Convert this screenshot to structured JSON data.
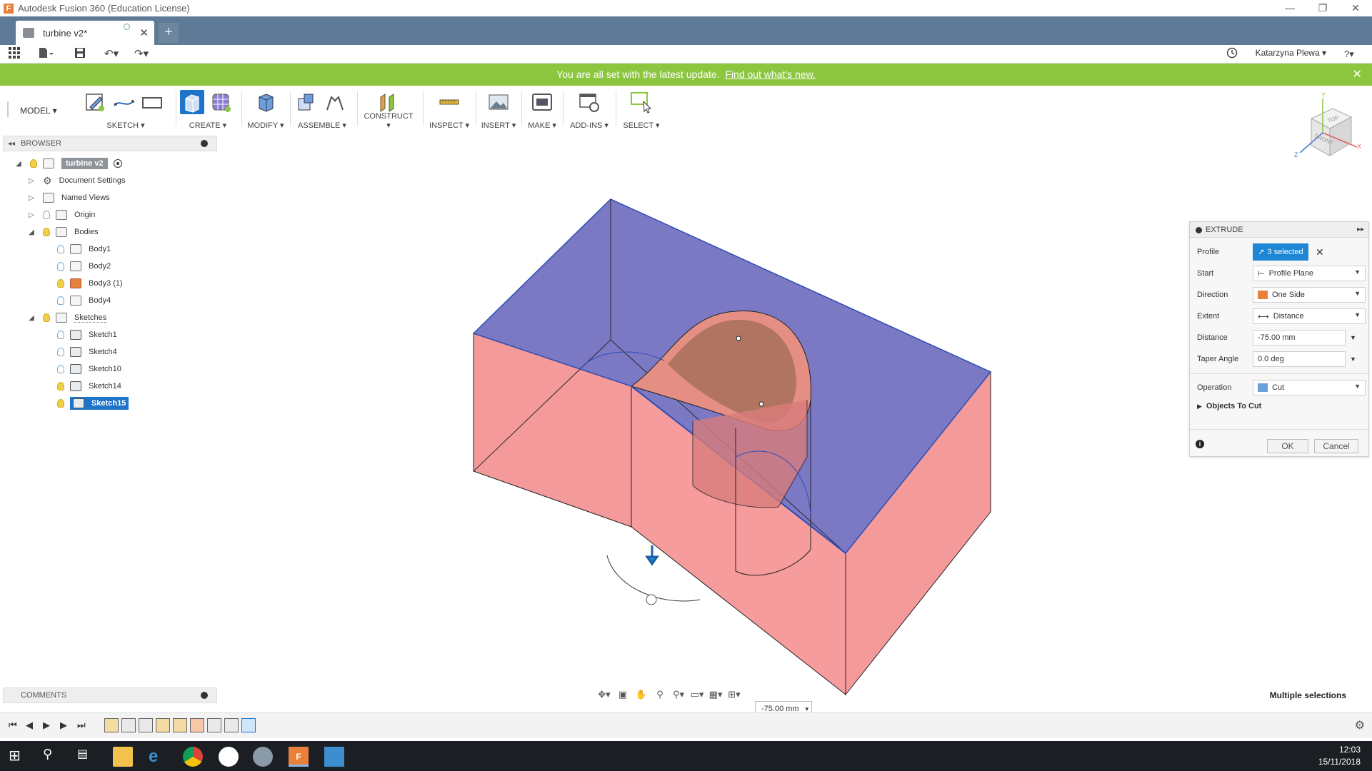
{
  "window": {
    "title": "Autodesk Fusion 360 (Education License)",
    "controls": [
      "—",
      "❐",
      "✕"
    ]
  },
  "tabs": {
    "active": "turbine v2*",
    "new_tab": "+"
  },
  "qat": {
    "user": "Katarzyna Plewa ▾",
    "help": "?▾"
  },
  "notification": {
    "text": "You are all set with the latest update.",
    "link": "Find out what's new.",
    "close": "✕"
  },
  "ribbon": {
    "workspace": "MODEL ▾",
    "groups": [
      "SKETCH ▾",
      "CREATE ▾",
      "MODIFY ▾",
      "ASSEMBLE ▾",
      "CONSTRUCT ▾",
      "INSPECT ▾",
      "INSERT ▾",
      "MAKE ▾",
      "ADD-INS ▾",
      "SELECT ▾"
    ]
  },
  "browser": {
    "title": "BROWSER",
    "root": "turbine v2",
    "items": {
      "doc_settings": "Document Settings",
      "named_views": "Named Views",
      "origin": "Origin",
      "bodies": "Bodies",
      "body1": "Body1",
      "body2": "Body2",
      "body3": "Body3 (1)",
      "body4": "Body4",
      "sketches": "Sketches",
      "sketch1": "Sketch1",
      "sketch4": "Sketch4",
      "sketch10": "Sketch10",
      "sketch14": "Sketch14",
      "sketch15": "Sketch15"
    }
  },
  "comments": {
    "title": "COMMENTS"
  },
  "viewcube": {
    "top": "TOP",
    "front": "FRONT",
    "x": "X",
    "y": "Y",
    "z": "Z"
  },
  "extrude": {
    "title": "EXTRUDE",
    "profile_label": "Profile",
    "profile_value": "3 selected",
    "start_label": "Start",
    "start_value": "Profile Plane",
    "direction_label": "Direction",
    "direction_value": "One Side",
    "extent_label": "Extent",
    "extent_value": "Distance",
    "distance_label": "Distance",
    "distance_value": "-75.00 mm",
    "taper_label": "Taper Angle",
    "taper_value": "0.0 deg",
    "operation_label": "Operation",
    "operation_value": "Cut",
    "objects_to_cut": "Objects To Cut",
    "ok": "OK",
    "cancel": "Cancel"
  },
  "viewport": {
    "dimension": "-75.00 mm"
  },
  "status": {
    "selection": "Multiple selections"
  },
  "taskbar": {
    "time": "12:03",
    "date": "15/11/2018"
  },
  "colors": {
    "tab_bar": "#5f7a96",
    "notify": "#8cc63f",
    "body_face": "#f59a9a",
    "top_face": "#7b78c4",
    "accent": "#1e86d4"
  }
}
